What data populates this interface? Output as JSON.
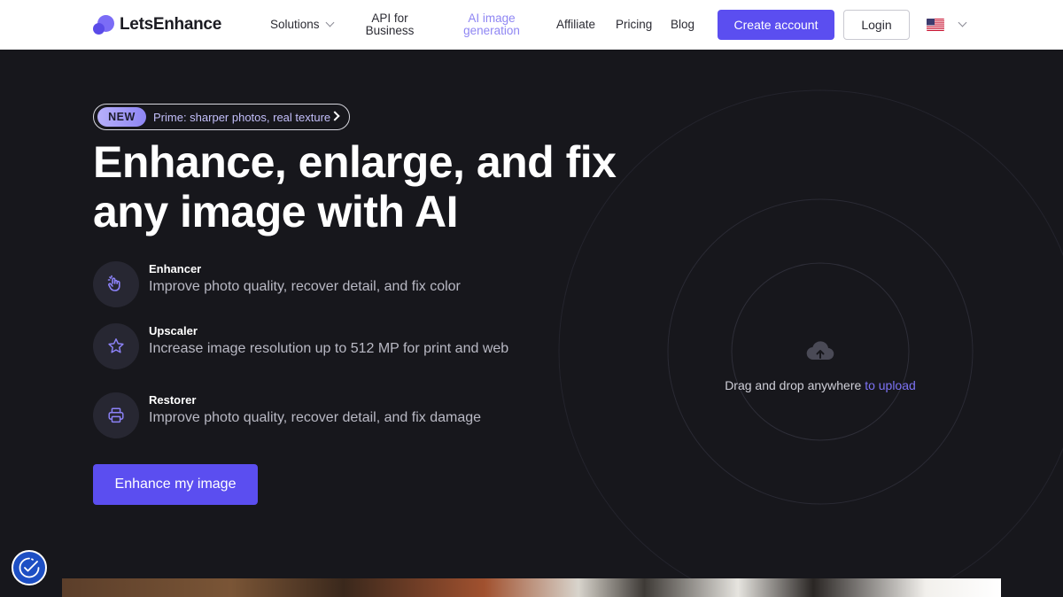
{
  "nav": {
    "logo_text": "LetsEnhance",
    "items": [
      {
        "label": "Solutions"
      },
      {
        "label": "API for\nBusiness"
      },
      {
        "label": "AI image\ngeneration"
      },
      {
        "label": "Affiliate"
      },
      {
        "label": "Pricing"
      },
      {
        "label": "Blog"
      }
    ],
    "create_account": "Create account",
    "login": "Login",
    "language_icon": "us-flag-icon"
  },
  "hero": {
    "badge_new": "NEW",
    "badge_text": "Prime: sharper photos, real texture",
    "headline": "Enhance, enlarge, and fix any image with AI",
    "features": [
      {
        "title": "Enhancer",
        "desc": "Improve photo quality, recover detail, and fix color",
        "icon": "magic-hand-icon"
      },
      {
        "title": "Upscaler",
        "desc": "Increase image resolution up to 512 MP for print and web",
        "icon": "star-icon"
      },
      {
        "title": "Restorer",
        "desc": "Improve photo quality, recover detail, and fix damage",
        "icon": "printer-icon"
      }
    ],
    "cta": "Enhance my image"
  },
  "dropzone": {
    "text": "Drag and drop anywhere ",
    "link": "to upload",
    "icon": "cloud-upload-icon"
  },
  "colors": {
    "accent": "#5b4ef0",
    "background": "#17171c",
    "link": "#7d73f5"
  }
}
